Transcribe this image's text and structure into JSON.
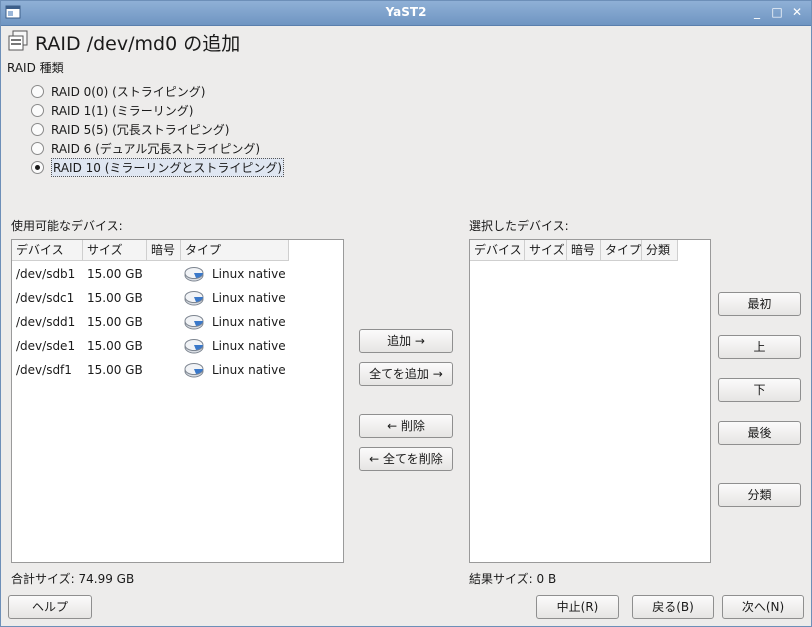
{
  "window": {
    "title": "YaST2",
    "minimize": "_",
    "maximize": "□",
    "close": "✕"
  },
  "heading": {
    "title": "RAID /dev/md0 の追加"
  },
  "raid_type": {
    "label": "RAID 種類",
    "options": [
      {
        "label": "RAID 0(0)  (ストライピング)",
        "checked": false
      },
      {
        "label": "RAID 1(1)  (ミラーリング)",
        "checked": false
      },
      {
        "label": "RAID 5(5)  (冗長ストライピング)",
        "checked": false
      },
      {
        "label": "RAID 6 (デュアル冗長ストライピング)",
        "checked": false
      },
      {
        "label": "RAID 10  (ミラーリングとストライピング)",
        "checked": true
      }
    ]
  },
  "available": {
    "label": "使用可能なデバイス:",
    "columns": [
      "デバイス",
      "サイズ",
      "暗号",
      "タイプ"
    ],
    "rows": [
      {
        "device": "/dev/sdb1",
        "size": "15.00 GB",
        "type": "Linux native",
        "icon": "hard-disk-icon"
      },
      {
        "device": "/dev/sdc1",
        "size": "15.00 GB",
        "type": "Linux native",
        "icon": "hard-disk-icon"
      },
      {
        "device": "/dev/sdd1",
        "size": "15.00 GB",
        "type": "Linux native",
        "icon": "hard-disk-icon"
      },
      {
        "device": "/dev/sde1",
        "size": "15.00 GB",
        "type": "Linux native",
        "icon": "hard-disk-icon"
      },
      {
        "device": "/dev/sdf1",
        "size": "15.00 GB",
        "type": "Linux native",
        "icon": "hard-disk-icon"
      }
    ],
    "total": "合計サイズ: 74.99 GB"
  },
  "selected": {
    "label": "選択したデバイス:",
    "columns": [
      "デバイス",
      "サイズ",
      "暗号",
      "タイプ",
      "分類"
    ],
    "result": "結果サイズ: 0 B"
  },
  "transfer": {
    "add": "追加 →",
    "add_all": "全てを追加 →",
    "remove": "← 削除",
    "remove_all": "← 全てを削除"
  },
  "order": {
    "top": "最初",
    "up": "上",
    "down": "下",
    "bottom": "最後",
    "classify": "分類"
  },
  "footer": {
    "help": "ヘルプ",
    "abort": "中止(R)",
    "back": "戻る(B)",
    "next": "次へ(N)"
  },
  "colors": {
    "titlebar": "#7fa3cf",
    "disk_accent": "#3a78c9"
  }
}
